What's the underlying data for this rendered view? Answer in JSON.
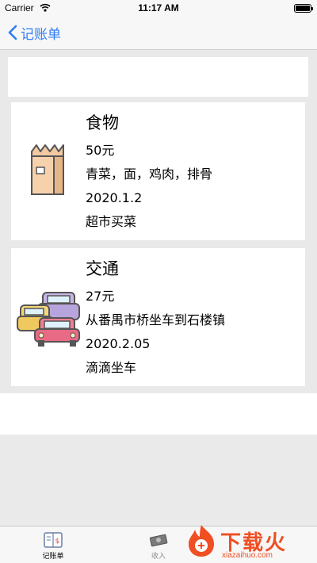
{
  "status_bar": {
    "carrier": "Carrier",
    "time": "11:17 AM",
    "wifi_icon": "wifi-icon",
    "battery_icon": "battery-icon"
  },
  "nav": {
    "back_label": "记账单",
    "back_icon": "chevron-left-icon",
    "accent_color": "#2f7cf6"
  },
  "records": [
    {
      "category": "食物",
      "amount": "50元",
      "detail": "青菜，面，鸡肉，排骨",
      "date": "2020.1.2",
      "note": "超市买菜",
      "icon": "food-bag-icon"
    },
    {
      "category": "交通",
      "amount": "27元",
      "detail": "从番禺市桥坐车到石楼镇",
      "date": "2020.2.05",
      "note": "滴滴坐车",
      "icon": "cars-icon"
    }
  ],
  "tab_bar": {
    "tabs": [
      {
        "label": "记账单",
        "icon": "ledger-book-icon",
        "selected": true
      },
      {
        "label": "收入",
        "icon": "money-icon",
        "selected": false
      }
    ]
  },
  "watermark": {
    "brand": "下载火",
    "url": "xiazaihuo.com",
    "color": "#f04e23"
  }
}
